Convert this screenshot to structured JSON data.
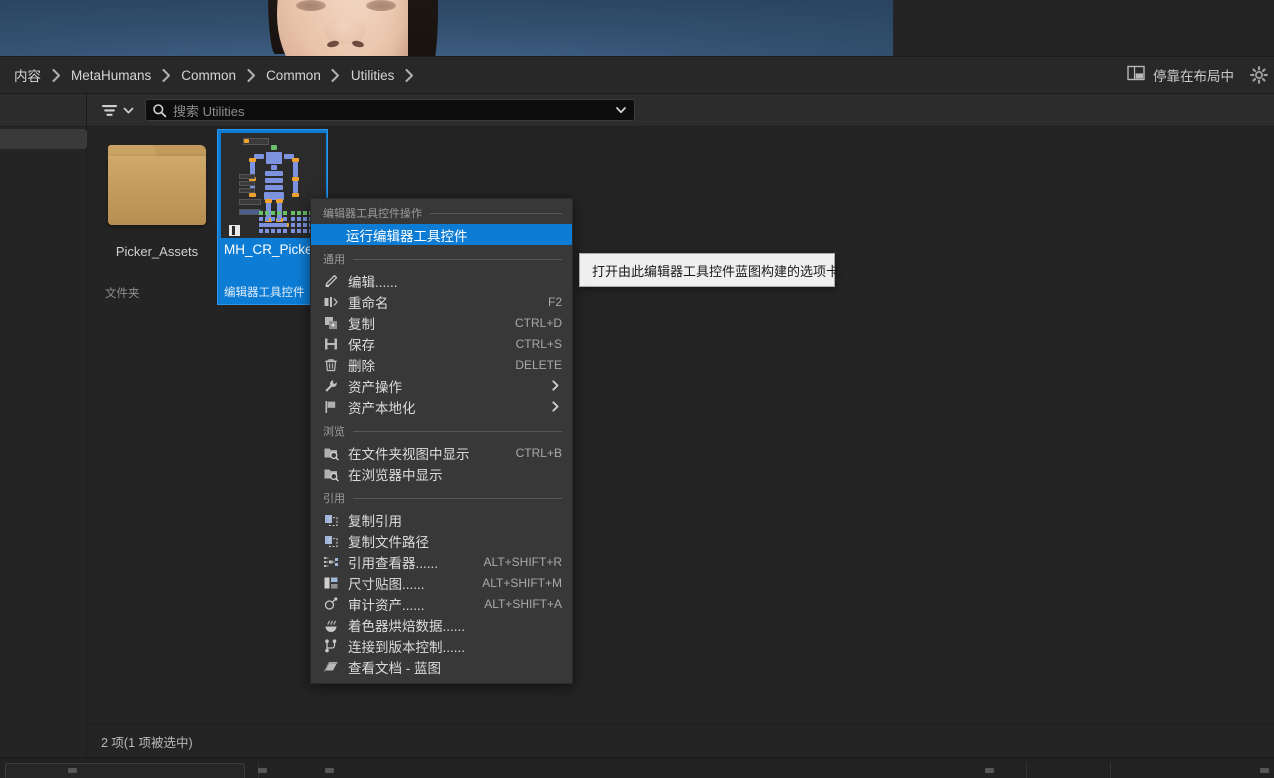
{
  "breadcrumb": {
    "items": [
      "内容",
      "MetaHumans",
      "Common",
      "Common",
      "Utilities"
    ],
    "dock_label": "停靠在布局中",
    "dock_icon": "layout-dock-icon",
    "gear_icon": "gear-icon"
  },
  "toolbar": {
    "filter_icon": "filter-icon",
    "filter_chevron_icon": "chevron-down-icon",
    "search_icon": "search-icon",
    "search_placeholder": "搜索 Utilities",
    "search_value": "",
    "search_chevron_icon": "chevron-down-icon"
  },
  "assets": [
    {
      "name": "Picker_Assets",
      "type": "文件夹",
      "icon": "folder-icon",
      "selected": false
    },
    {
      "name": "MH_CR_Picker",
      "type": "编辑器工具控件",
      "icon": "editor-utility-widget-thumbnail",
      "selected": true
    }
  ],
  "status": {
    "text": "2 项(1 项被选中)"
  },
  "context_menu": {
    "sections": [
      {
        "label": "编辑器工具控件操作",
        "items": [
          {
            "label": "运行编辑器工具控件",
            "shortcut": "",
            "icon": "",
            "highlight": true,
            "submenu": false
          }
        ]
      },
      {
        "label": "通用",
        "items": [
          {
            "label": "编辑......",
            "shortcut": "",
            "icon": "pencil-icon",
            "highlight": false,
            "submenu": false
          },
          {
            "label": "重命名",
            "shortcut": "F2",
            "icon": "rename-icon",
            "highlight": false,
            "submenu": false
          },
          {
            "label": "复制",
            "shortcut": "CTRL+D",
            "icon": "duplicate-icon",
            "highlight": false,
            "submenu": false
          },
          {
            "label": "保存",
            "shortcut": "CTRL+S",
            "icon": "save-icon",
            "highlight": false,
            "submenu": false
          },
          {
            "label": "删除",
            "shortcut": "DELETE",
            "icon": "trash-icon",
            "highlight": false,
            "submenu": false
          },
          {
            "label": "资产操作",
            "shortcut": "",
            "icon": "wrench-icon",
            "highlight": false,
            "submenu": true
          },
          {
            "label": "资产本地化",
            "shortcut": "",
            "icon": "flag-icon",
            "highlight": false,
            "submenu": true
          }
        ]
      },
      {
        "label": "浏览",
        "items": [
          {
            "label": "在文件夹视图中显示",
            "shortcut": "CTRL+B",
            "icon": "folder-search-icon",
            "highlight": false,
            "submenu": false
          },
          {
            "label": "在浏览器中显示",
            "shortcut": "",
            "icon": "folder-search-icon",
            "highlight": false,
            "submenu": false
          }
        ]
      },
      {
        "label": "引用",
        "items": [
          {
            "label": "复制引用",
            "shortcut": "",
            "icon": "copy-reference-icon",
            "highlight": false,
            "submenu": false
          },
          {
            "label": "复制文件路径",
            "shortcut": "",
            "icon": "copy-path-icon",
            "highlight": false,
            "submenu": false
          },
          {
            "label": "引用查看器......",
            "shortcut": "ALT+SHIFT+R",
            "icon": "reference-viewer-icon",
            "highlight": false,
            "submenu": false
          },
          {
            "label": "尺寸贴图......",
            "shortcut": "ALT+SHIFT+M",
            "icon": "size-map-icon",
            "highlight": false,
            "submenu": false
          },
          {
            "label": "审计资产......",
            "shortcut": "ALT+SHIFT+A",
            "icon": "audit-assets-icon",
            "highlight": false,
            "submenu": false
          },
          {
            "label": "着色器烘焙数据......",
            "shortcut": "",
            "icon": "shader-cook-icon",
            "highlight": false,
            "submenu": false
          },
          {
            "label": "连接到版本控制......",
            "shortcut": "",
            "icon": "source-control-icon",
            "highlight": false,
            "submenu": false
          },
          {
            "label": "查看文档 - 蓝图",
            "shortcut": "",
            "icon": "documentation-icon",
            "highlight": false,
            "submenu": false
          }
        ]
      }
    ]
  },
  "tooltip": {
    "text": "打开由此编辑器工具控件蓝图构建的选项卡。"
  },
  "colors": {
    "accent_blue": "#0c7cd5",
    "menu_bg": "#383838",
    "panel_bg": "#242424",
    "toolbar_bg": "#2c2c2c",
    "tooltip_bg": "#efefef",
    "folder_gold": "#c39b5d"
  }
}
